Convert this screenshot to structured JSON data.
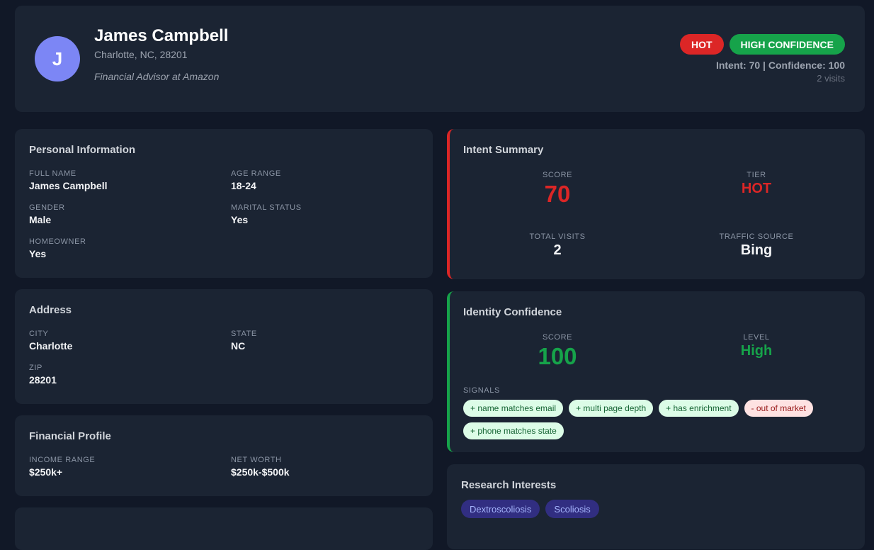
{
  "header": {
    "avatar_initial": "J",
    "name": "James Campbell",
    "location": "Charlotte, NC, 28201",
    "job": "Financial Advisor at Amazon",
    "badge_hot": "HOT",
    "badge_confidence": "HIGH CONFIDENCE",
    "scores": "Intent: 70 | Confidence: 100",
    "visits": "2 visits"
  },
  "personal": {
    "title": "Personal Information",
    "full_name_label": "FULL NAME",
    "full_name": "James Campbell",
    "age_label": "AGE RANGE",
    "age": "18-24",
    "gender_label": "GENDER",
    "gender": "Male",
    "marital_label": "MARITAL STATUS",
    "marital": "Yes",
    "homeowner_label": "HOMEOWNER",
    "homeowner": "Yes"
  },
  "address": {
    "title": "Address",
    "city_label": "CITY",
    "city": "Charlotte",
    "state_label": "STATE",
    "state": "NC",
    "zip_label": "ZIP",
    "zip": "28201"
  },
  "financial": {
    "title": "Financial Profile",
    "income_label": "INCOME RANGE",
    "income": "$250k+",
    "networth_label": "NET WORTH",
    "networth": "$250k-$500k"
  },
  "intent": {
    "title": "Intent Summary",
    "score_label": "SCORE",
    "score": "70",
    "tier_label": "TIER",
    "tier": "HOT",
    "visits_label": "TOTAL VISITS",
    "visits": "2",
    "source_label": "TRAFFIC SOURCE",
    "source": "Bing"
  },
  "identity": {
    "title": "Identity Confidence",
    "score_label": "SCORE",
    "score": "100",
    "level_label": "LEVEL",
    "level": "High",
    "signals_label": "SIGNALS",
    "signals": [
      "+ name matches email",
      "+ multi page depth",
      "+ has enrichment",
      "- out of market",
      "+ phone matches state"
    ]
  },
  "research": {
    "title": "Research Interests",
    "interests": [
      "Dextroscoliosis",
      "Scoliosis"
    ]
  },
  "colors": {
    "hot": "#dc2626",
    "high": "#16a34a",
    "avatar": "#7c86f5",
    "card": "#1b2433",
    "page": "#111827"
  }
}
